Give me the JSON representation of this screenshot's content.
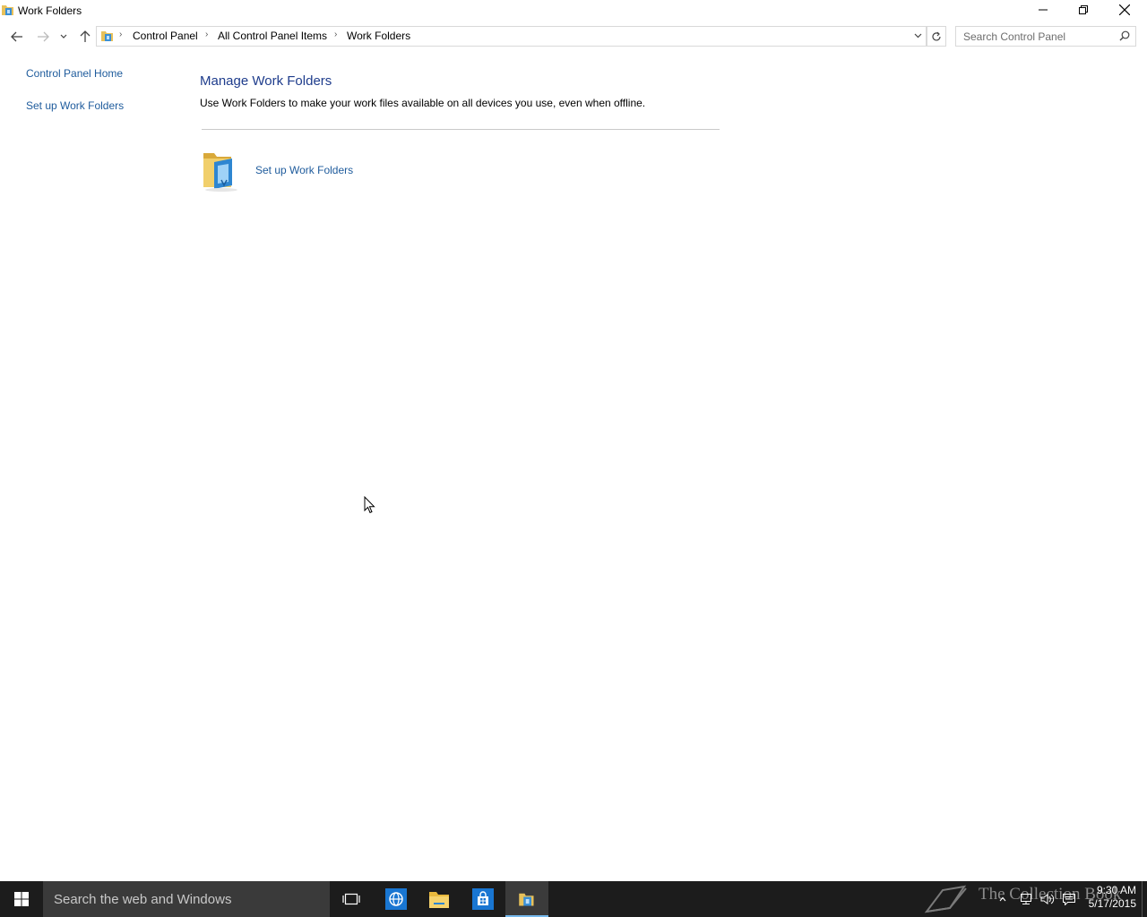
{
  "window": {
    "title": "Work Folders",
    "icon": "work-folders-icon"
  },
  "nav": {
    "breadcrumbs": [
      "Control Panel",
      "All Control Panel Items",
      "Work Folders"
    ],
    "search_placeholder": "Search Control Panel"
  },
  "left_pane": {
    "home_link": "Control Panel Home",
    "setup_link": "Set up Work Folders"
  },
  "main": {
    "title": "Manage Work Folders",
    "description": "Use Work Folders to make your work files available on all devices you use, even when offline.",
    "task_link": "Set up Work Folders"
  },
  "taskbar": {
    "search_placeholder": "Search the web and Windows",
    "pinned": [
      "task-view-icon",
      "internet-explorer-icon",
      "file-explorer-icon",
      "store-icon",
      "work-folders-icon"
    ],
    "watermark": "The Collection Book",
    "clock_time": "9:30 AM",
    "clock_date": "5/17/2015"
  },
  "colors": {
    "link": "#1e5b9c",
    "heading": "#1e3c8c",
    "taskbar": "#1c1c1c",
    "search_bg": "#3a3a3a"
  }
}
